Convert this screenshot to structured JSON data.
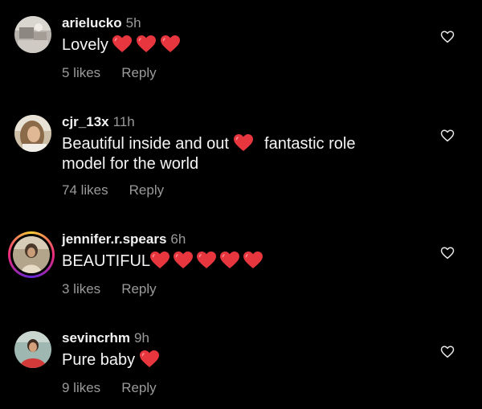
{
  "colors": {
    "background": "#000000",
    "text": "#f5f5f5",
    "muted": "#9a9a9a",
    "heart": "#e8363f"
  },
  "comments": [
    {
      "username": "arielucko",
      "time": "5h",
      "text_parts": [
        "Lovely "
      ],
      "hearts": 3,
      "likes": "5 likes",
      "reply": "Reply",
      "icon": "heart-outline-icon"
    },
    {
      "username": "cjr_13x",
      "time": "11h",
      "text_parts": [
        "Beautiful inside and out ",
        " fantastic role model for the world"
      ],
      "hearts": 1,
      "likes": "74 likes",
      "reply": "Reply",
      "icon": "heart-outline-icon"
    },
    {
      "username": "jennifer.r.spears",
      "time": "6h",
      "text_parts": [
        "BEAUTIFUL"
      ],
      "hearts": 5,
      "likes": "3 likes",
      "reply": "Reply",
      "icon": "heart-outline-icon"
    },
    {
      "username": "sevincrhm",
      "time": "9h",
      "text_parts": [
        "Pure baby "
      ],
      "hearts": 1,
      "likes": "9 likes",
      "reply": "Reply",
      "icon": "heart-outline-icon"
    }
  ]
}
